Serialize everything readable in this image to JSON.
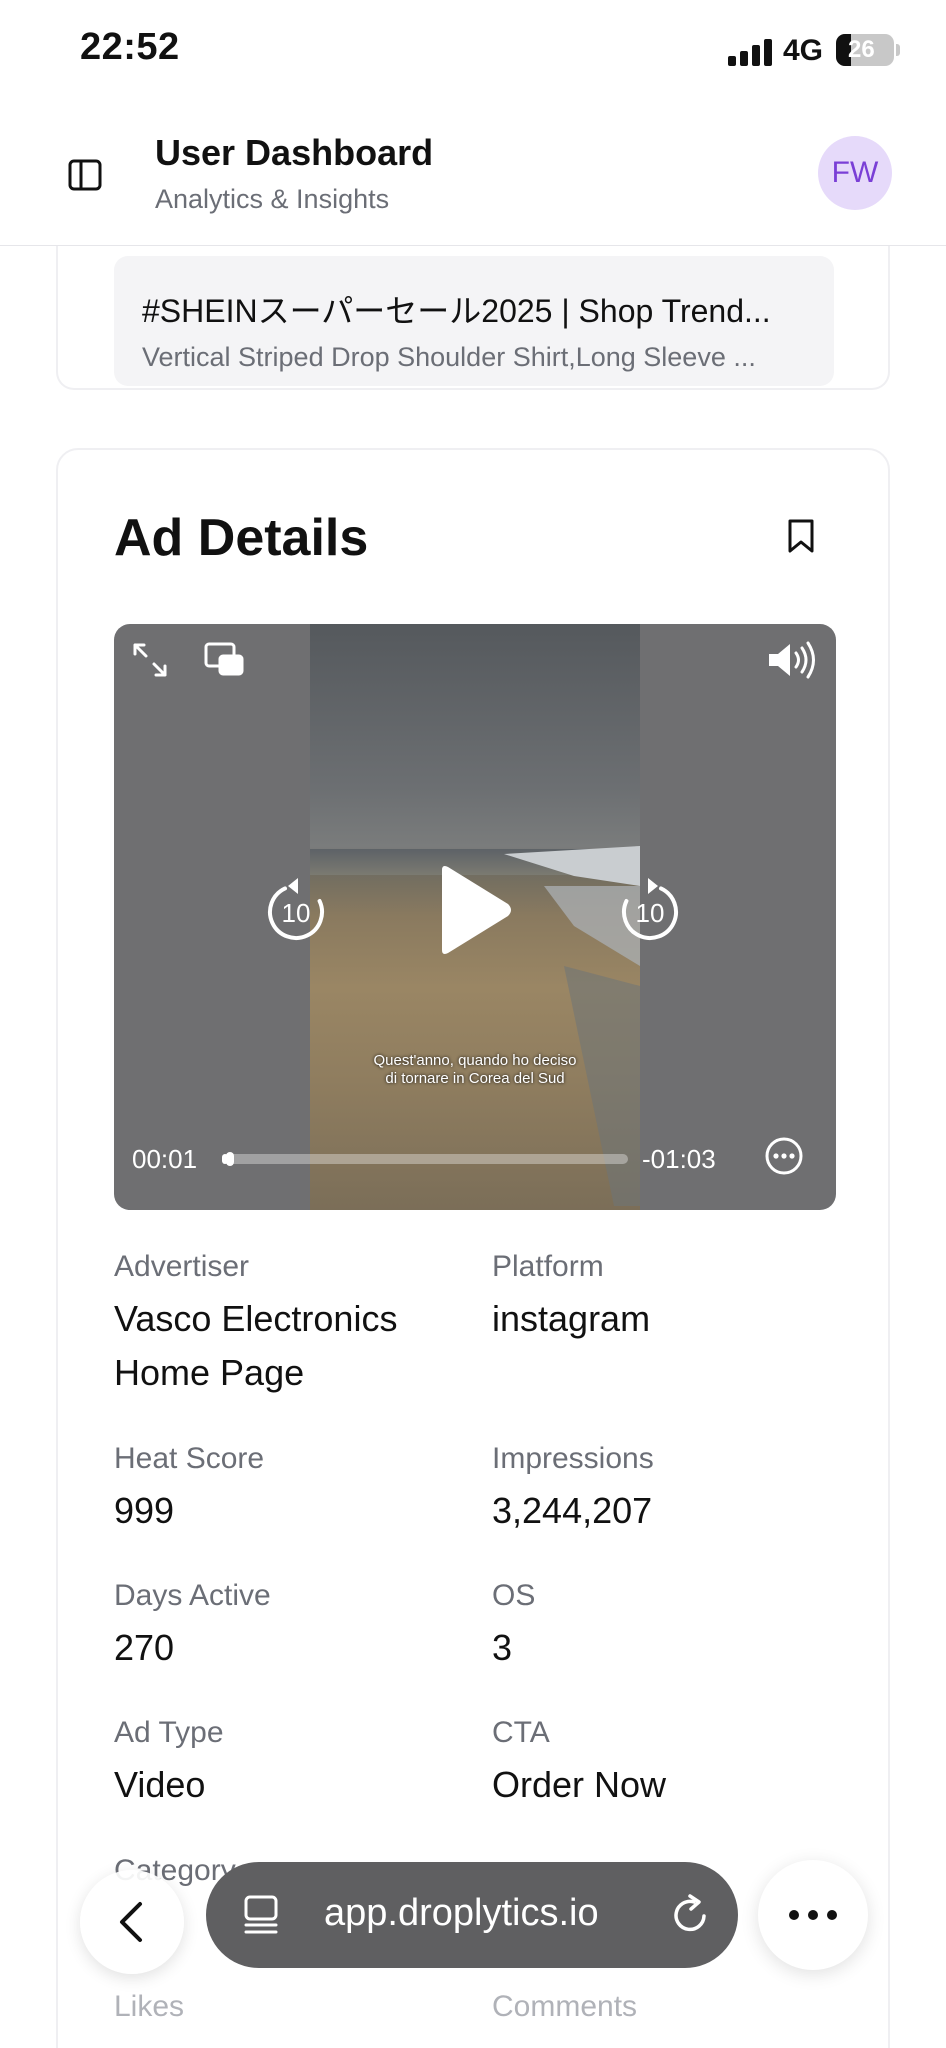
{
  "status_bar": {
    "time": "22:52",
    "network": "4G",
    "battery": "26",
    "battery_level": 0.26
  },
  "header": {
    "title": "User Dashboard",
    "subtitle": "Analytics & Insights",
    "avatar_initials": "FW"
  },
  "ad_card": {
    "title": "#SHEINスーパーセール2025 | Shop Trend...",
    "description": "Vertical Striped Drop Shoulder Shirt,Long Sleeve ..."
  },
  "details": {
    "title": "Ad Details",
    "video": {
      "subtitle_line1": "Quest'anno, quando ho deciso",
      "subtitle_line2": "di tornare in Corea del Sud",
      "time_current": "00:01",
      "time_remaining": "-01:03",
      "progress": 0.016,
      "skip_back_seconds": "10",
      "skip_forward_seconds": "10"
    },
    "fields": [
      {
        "label": "Advertiser",
        "value": "Vasco Electronics Home Page"
      },
      {
        "label": "Platform",
        "value": "instagram"
      },
      {
        "label": "Heat Score",
        "value": "999"
      },
      {
        "label": "Impressions",
        "value": "3,244,207"
      },
      {
        "label": "Days Active",
        "value": "270"
      },
      {
        "label": "OS",
        "value": "3"
      },
      {
        "label": "Ad Type",
        "value": "Video"
      },
      {
        "label": "CTA",
        "value": "Order Now"
      },
      {
        "label": "Category",
        "value": ""
      },
      {
        "label": "Likes",
        "value": ""
      },
      {
        "label": "Comments",
        "value": ""
      }
    ]
  },
  "browser": {
    "url": "app.droplytics.io"
  },
  "icons": {
    "sidebar": "sidebar-toggle-icon",
    "bookmark": "bookmark-icon",
    "fullscreen": "expand-icon",
    "pip": "picture-in-picture-icon",
    "volume": "volume-icon",
    "play": "play-icon",
    "more": "more-icon",
    "back": "chevron-left-icon",
    "reload": "reload-icon",
    "tabs": "tab-overview-icon"
  },
  "colors": {
    "accent": "#7a3fd6",
    "avatar_bg": "#e6dafa",
    "muted_text": "#6b6e76",
    "url_pill": "#5f5f61"
  }
}
